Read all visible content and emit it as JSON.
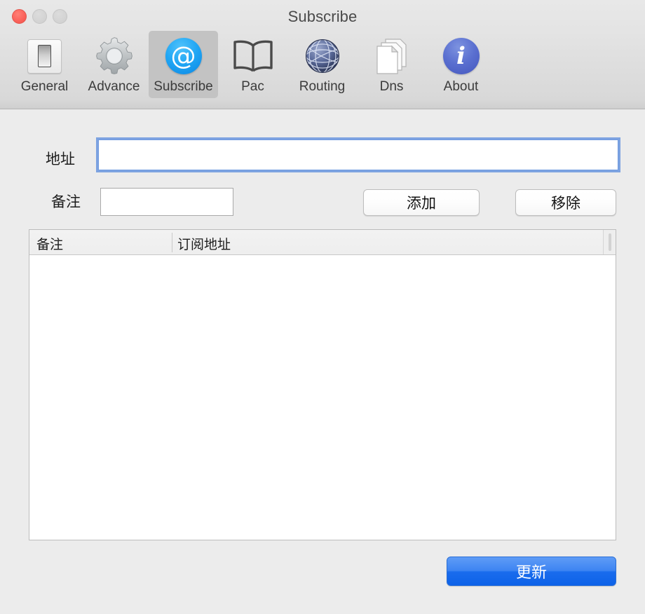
{
  "window": {
    "title": "Subscribe",
    "controls": {
      "close": "close-button",
      "minimize": "minimize-button",
      "zoom": "zoom-button"
    }
  },
  "toolbar": {
    "tabs": [
      {
        "label": "General",
        "icon": "toggle-switch-icon",
        "selected": false
      },
      {
        "label": "Advance",
        "icon": "gear-icon",
        "selected": false
      },
      {
        "label": "Subscribe",
        "icon": "at-sign-icon",
        "selected": true
      },
      {
        "label": "Pac",
        "icon": "open-book-icon",
        "selected": false
      },
      {
        "label": "Routing",
        "icon": "globe-icon",
        "selected": false
      },
      {
        "label": "Dns",
        "icon": "documents-icon",
        "selected": false
      },
      {
        "label": "About",
        "icon": "info-icon",
        "selected": false
      }
    ]
  },
  "form": {
    "address_label": "地址",
    "address_value": "",
    "address_placeholder": "",
    "remark_label": "备注",
    "remark_value": "",
    "remark_placeholder": "",
    "add_button": "添加",
    "remove_button": "移除"
  },
  "table": {
    "columns": [
      "备注",
      "订阅地址"
    ],
    "rows": []
  },
  "footer": {
    "update_button": "更新"
  },
  "colors": {
    "accent": "#1a6ced",
    "focus_ring": "#6a97df",
    "toolbar_selected": "#c3c3c3",
    "window_bg": "#ececec",
    "close_button": "#fb635c"
  }
}
